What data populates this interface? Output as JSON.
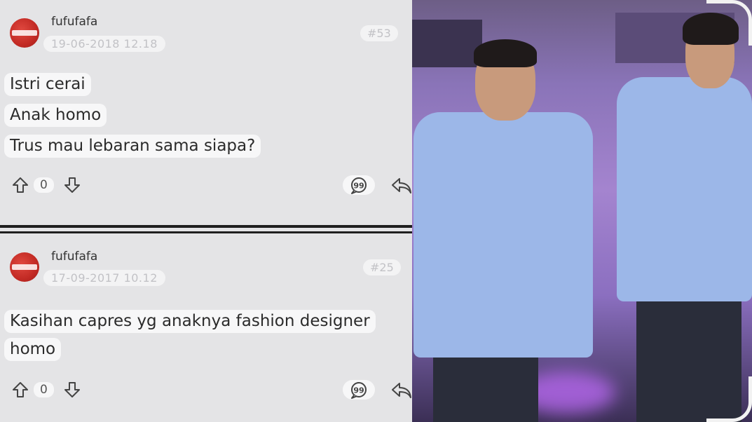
{
  "posts": [
    {
      "username": "fufufafa",
      "timestamp": "19-06-2018 12.18",
      "post_number": "#53",
      "lines": [
        "Istri cerai",
        "Anak homo",
        "Trus mau lebaran sama siapa?"
      ],
      "vote_count": "0"
    },
    {
      "username": "fufufafa",
      "timestamp": "17-09-2017 10.12",
      "post_number": "#25",
      "lines": [
        "Kasihan capres yg anaknya fashion designer",
        "homo"
      ],
      "vote_count": "0"
    }
  ],
  "icons": {
    "upvote": "arrow-up-icon",
    "downvote": "arrow-down-icon",
    "quote": "quote-bubble-icon",
    "reply": "reply-arrow-icon"
  },
  "colors": {
    "panel_bg": "#e4e4e6",
    "text": "#2b2b2b",
    "avatar_red": "#c22a24",
    "shirt_blue": "#9cb7e8",
    "stage_purple": "#a484cf"
  }
}
